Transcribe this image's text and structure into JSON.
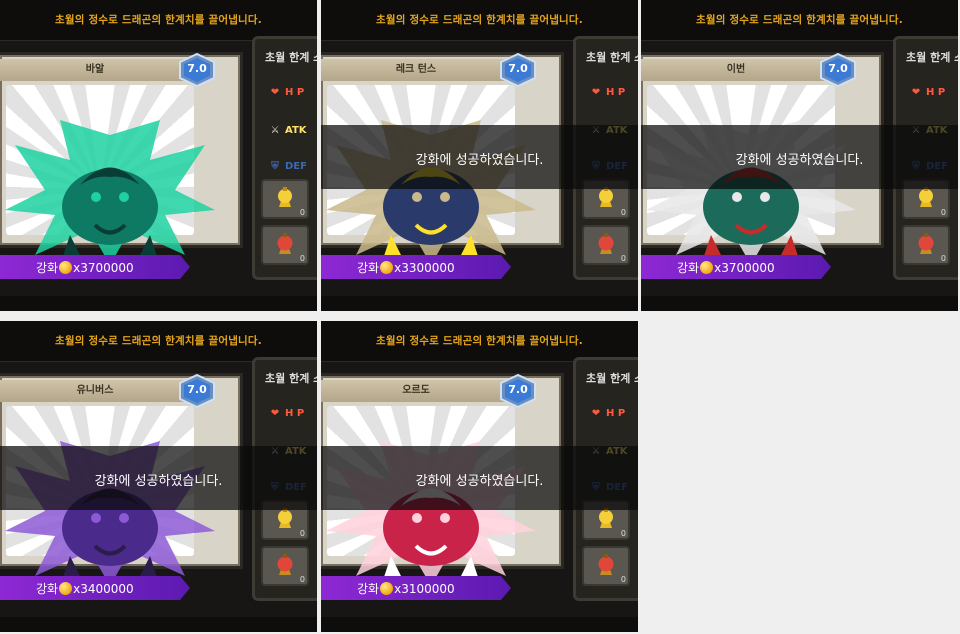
{
  "header_text": "초월의 정수로 드래곤의 한계치를 끌어냅니다.",
  "stats_title": "초월 한계 스",
  "stat_labels": {
    "hp": "H P",
    "atk": "ATK",
    "def": "DEF"
  },
  "level_badge": "7.0",
  "slot_count": "0",
  "upgrade_label": "강화",
  "toast_text": "강화에 성공하였습니다.",
  "colors": {
    "header": "#e4a51c",
    "cost_bar": "#7a24c8",
    "badge": "#3b7bd6"
  },
  "tiles": [
    {
      "name": "바알",
      "cost": "x3700000",
      "dragon_colors": [
        "#0f7a64",
        "#1fd1a0",
        "#0a3d35"
      ],
      "toast_visible": false
    },
    {
      "name": "레크 턴스",
      "cost": "x3300000",
      "dragon_colors": [
        "#2a3a6a",
        "#c9b98a",
        "#ffe12a"
      ],
      "toast_visible": true
    },
    {
      "name": "이번",
      "cost": "x3700000",
      "dragon_colors": [
        "#1b6a5a",
        "#e8e8e8",
        "#c62c2c"
      ],
      "toast_visible": true
    },
    {
      "name": "유니버스",
      "cost": "x3400000",
      "dragon_colors": [
        "#4a2a8a",
        "#8d5ad6",
        "#2a1d4a"
      ],
      "toast_visible": true
    },
    {
      "name": "오르도",
      "cost": "x3100000",
      "dragon_colors": [
        "#c9234a",
        "#ffd1dd",
        "#ffffff"
      ],
      "toast_visible": true
    }
  ]
}
